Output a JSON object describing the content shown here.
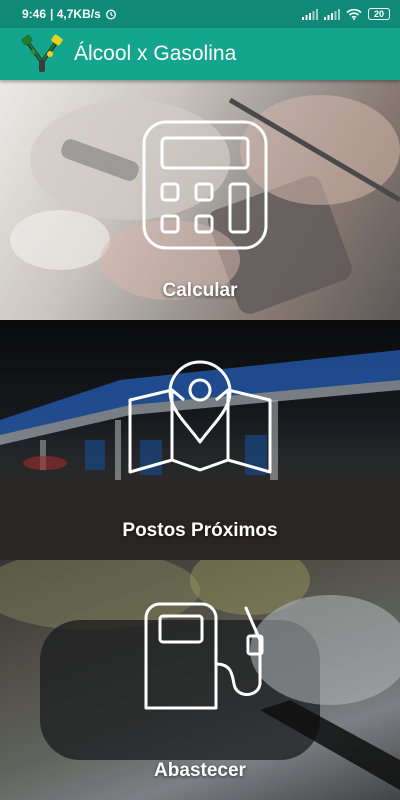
{
  "status_bar": {
    "time": "9:46",
    "net_speed": "| 4,7KB/s",
    "battery": "20"
  },
  "app_bar": {
    "title": "Álcool x Gasolina",
    "logo_icon": "pump-nozzles-logo-icon"
  },
  "menu": [
    {
      "label": "Calcular",
      "icon": "calculator-icon"
    },
    {
      "label": "Postos Próximos",
      "icon": "map-pin-icon"
    },
    {
      "label": "Abastecer",
      "icon": "fuel-pump-icon"
    }
  ],
  "colors": {
    "status_bar": "#0f8a78",
    "app_bar": "#13a58e",
    "icon_stroke": "#ffffff"
  }
}
